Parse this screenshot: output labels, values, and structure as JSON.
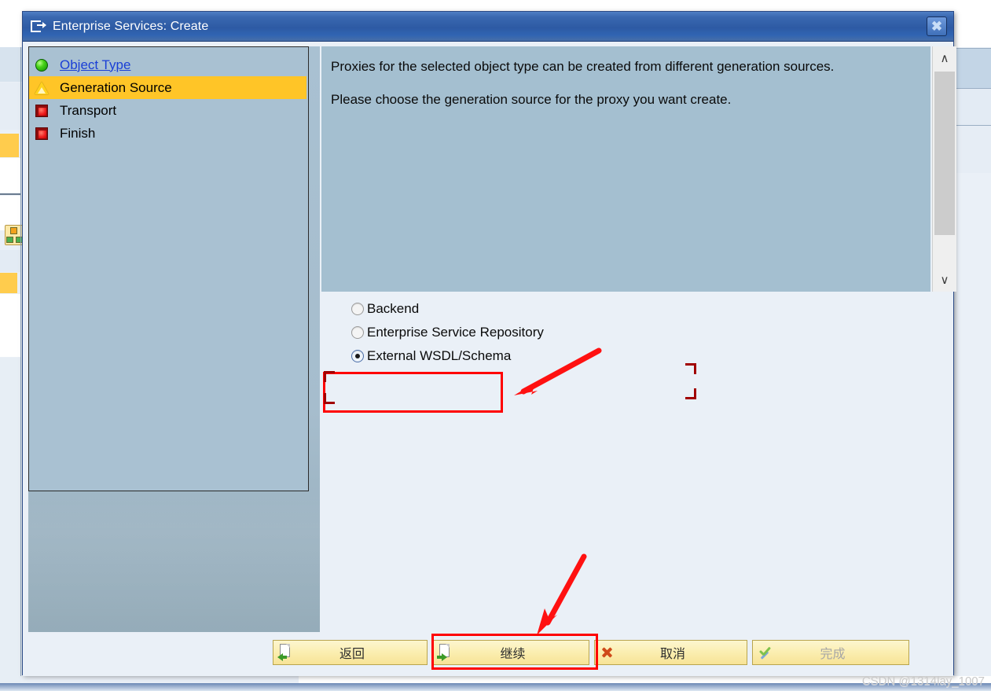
{
  "window": {
    "title": "Enterprise Services: Create",
    "title_icon": "wizard-export-icon",
    "close_label": "✖"
  },
  "roadmap": {
    "items": [
      {
        "label": "Object Type",
        "icon": "green-sphere-icon",
        "state": "completed-link"
      },
      {
        "label": "Generation Source",
        "icon": "yellow-warning-icon",
        "state": "current"
      },
      {
        "label": "Transport",
        "icon": "red-square-icon",
        "state": "pending"
      },
      {
        "label": "Finish",
        "icon": "red-square-icon",
        "state": "pending"
      }
    ]
  },
  "instructions": {
    "paragraph1": "Proxies for the selected object type can be created from different generation sources.",
    "paragraph2": "Please choose the generation source for the proxy you want create."
  },
  "scrollbar": {
    "up_glyph": "∧",
    "down_glyph": "∨"
  },
  "generation_source": {
    "options": [
      {
        "label": "Backend",
        "selected": false
      },
      {
        "label": "Enterprise Service Repository",
        "selected": false
      },
      {
        "label": "External WSDL/Schema",
        "selected": true
      }
    ]
  },
  "footer": {
    "buttons": [
      {
        "label": "返回",
        "icon": "back-doc-icon",
        "enabled": true,
        "highlighted": false
      },
      {
        "label": "继续",
        "icon": "continue-doc-icon",
        "enabled": true,
        "highlighted": true
      },
      {
        "label": "取消",
        "icon": "cancel-x-icon",
        "enabled": true,
        "highlighted": false
      },
      {
        "label": "完成",
        "icon": "finish-check-icon",
        "enabled": false,
        "highlighted": false
      }
    ]
  },
  "annotations": {
    "highlight_color": "#ff0000",
    "bracket_color": "#a10000",
    "arrow_to_radio": "red-arrow-icon",
    "arrow_to_continue": "red-arrow-icon"
  },
  "watermark": {
    "text": "CSDN @1314lay_1007"
  }
}
